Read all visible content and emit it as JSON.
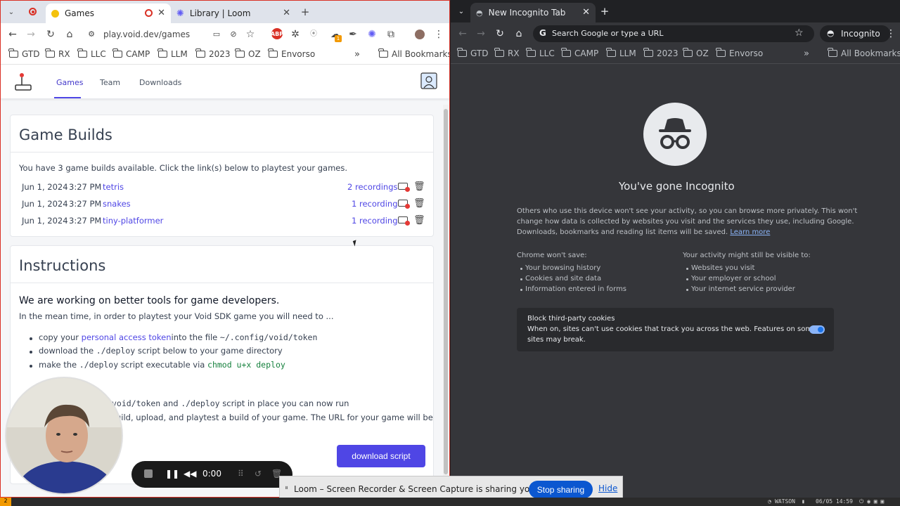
{
  "left_browser": {
    "tabs": [
      {
        "label": "Games",
        "active": true
      },
      {
        "label": "Library | Loom",
        "active": false
      }
    ],
    "url": "play.void.dev/games",
    "bookmarks": [
      "GTD",
      "RX",
      "LLC",
      "CAMP",
      "LLM",
      "2023",
      "OZ",
      "Envorso"
    ],
    "all_bookmarks": "All Bookmarks",
    "extension_badge": "1",
    "abp_label": "ABP"
  },
  "site": {
    "nav": [
      "Games",
      "Team",
      "Downloads"
    ],
    "builds": {
      "title": "Game Builds",
      "summary": "You have 3 game builds available. Click the link(s) below to playtest your games.",
      "rows": [
        {
          "date": "Jun 1, 2024",
          "time": "3:27 PM",
          "name": "tetris",
          "recordings": "2 recordings"
        },
        {
          "date": "Jun 1, 2024",
          "time": "3:27 PM",
          "name": "snakes",
          "recordings": "1 recording"
        },
        {
          "date": "Jun 1, 2024",
          "time": "3:27 PM",
          "name": "tiny-platformer",
          "recordings": "1 recording"
        }
      ]
    },
    "instructions": {
      "title": "Instructions",
      "subtitle": "We are working on better tools for game developers.",
      "intro": "In the mean time, in order to playtest your Void SDK game you will need to ...",
      "b1_pre": "copy your ",
      "b1_link": "personal access token",
      "b1_mid": "into the file ",
      "b1_code": "~/.config/void/token",
      "b2_pre": "download the ",
      "b2_code": "./deploy",
      "b2_post": " script below to your game directory",
      "b3_pre": "make the ",
      "b3_code": "./deploy",
      "b3_mid": " script executable via ",
      "b3_code2": "chmod u+x deploy",
      "p2_code1": "void/token",
      "p2_and": " and ",
      "p2_code2": "./deploy",
      "p2_post": " script in place you can now run",
      "p3": "uild, upload, and playtest a build of your game. The URL for your game will be",
      "download_button": "download script"
    }
  },
  "right_browser": {
    "tab_label": "New Incognito Tab",
    "omnibox_placeholder": "Search Google or type a URL",
    "incognito_label": "Incognito",
    "bookmarks": [
      "GTD",
      "RX",
      "LLC",
      "CAMP",
      "LLM",
      "2023",
      "OZ",
      "Envorso"
    ],
    "all_bookmarks": "All Bookmarks",
    "heading": "You've gone Incognito",
    "para_line1": "Others who use this device won't see your activity, so you can browse more privately. This won't",
    "para_line2": "change how data is collected by websites you visit and the services they use, including Google.",
    "para_line3": "Downloads, bookmarks and reading list items will be saved.",
    "learn_more": "Learn more",
    "wont_save_title": "Chrome won't save:",
    "wont_save": [
      "Your browsing history",
      "Cookies and site data",
      "Information entered in forms"
    ],
    "visible_title": "Your activity might still be visible to:",
    "visible": [
      "Websites you visit",
      "Your employer or school",
      "Your internet service provider"
    ],
    "cookies_title": "Block third-party cookies",
    "cookies_line1": "When on, sites can't use cookies that track you across the web. Features on some",
    "cookies_line2": "sites may break."
  },
  "loom": {
    "timer": "0:00",
    "share_text": "Loom – Screen Recorder & Screen Capture is sharing your screen.",
    "stop_sharing": "Stop sharing",
    "hide": "Hide"
  },
  "statusbar": {
    "workspace": "2",
    "host": "WATSON",
    "datetime": "06/05 14:59"
  },
  "colors": {
    "accent": "#4f46e5",
    "record_red": "#d93025",
    "incognito_bg": "#35363a",
    "stop_blue": "#0b57d0"
  }
}
